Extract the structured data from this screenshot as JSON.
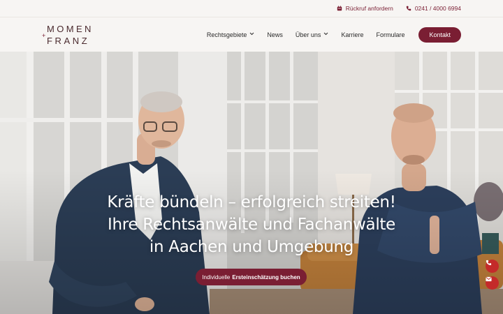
{
  "topbar": {
    "callback_label": "Rückruf anfordern",
    "phone": "0241 / 4000 6994"
  },
  "logo": {
    "line1": "MOMEN",
    "line2": "FRANZ",
    "plus": "+"
  },
  "nav": {
    "items": [
      {
        "label": "Rechtsgebiete",
        "has_dropdown": true
      },
      {
        "label": "News",
        "has_dropdown": false
      },
      {
        "label": "Über uns",
        "has_dropdown": true
      },
      {
        "label": "Karriere",
        "has_dropdown": false
      },
      {
        "label": "Formulare",
        "has_dropdown": false
      }
    ],
    "contact_button": "Kontakt",
    "chevron": "⌄"
  },
  "hero": {
    "headline_line1": "Kräfte bündeln – erfolgreich streiten!",
    "headline_line2": "Ihre Rechtsanwälte und Fachanwälte",
    "headline_line3": "in Aachen und Umgebung",
    "cta_prefix": "Individuelle",
    "cta_bold": "Ersteinschätzung buchen"
  },
  "floating": {
    "phone_icon": "phone-icon",
    "mail_icon": "mail-icon"
  },
  "colors": {
    "accent": "#7a1e33",
    "float_red": "#c42a2a",
    "sweater": "#2c3e57"
  }
}
